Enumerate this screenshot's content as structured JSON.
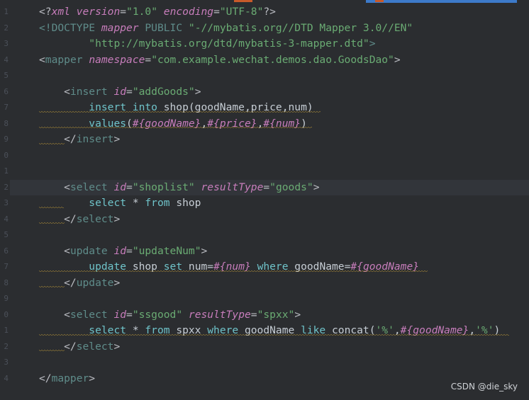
{
  "editor": {
    "lines": [
      {
        "parts": [
          [
            "decl",
            "<?"
          ],
          [
            "attri",
            "xml "
          ],
          [
            "attri",
            "version"
          ],
          [
            "decl",
            "="
          ],
          [
            "val",
            "\"1.0\""
          ],
          [
            "decl",
            " "
          ],
          [
            "attri",
            "encoding"
          ],
          [
            "decl",
            "="
          ],
          [
            "val",
            "\"UTF-8\""
          ],
          [
            "decl",
            "?>"
          ]
        ]
      },
      {
        "parts": [
          [
            "tagc",
            "<!DOCTYPE "
          ],
          [
            "attri",
            "mapper "
          ],
          [
            "tagc",
            "PUBLIC "
          ],
          [
            "val",
            "\"-//mybatis.org//DTD Mapper 3.0//EN\""
          ]
        ]
      },
      {
        "parts": [
          [
            "plain",
            "        "
          ],
          [
            "val",
            "\"http://mybatis.org/dtd/mybatis-3-mapper.dtd\""
          ],
          [
            "tagc",
            ">"
          ]
        ]
      },
      {
        "parts": [
          [
            "plain",
            "<"
          ],
          [
            "tagc",
            "mapper "
          ],
          [
            "attri",
            "namespace"
          ],
          [
            "plain",
            "="
          ],
          [
            "val",
            "\"com.example.wechat.demos.dao.GoodsDao\""
          ],
          [
            "plain",
            ">"
          ]
        ]
      },
      {
        "parts": []
      },
      {
        "parts": [
          [
            "plain",
            "    <"
          ],
          [
            "tagc",
            "insert "
          ],
          [
            "attri",
            "id"
          ],
          [
            "plain",
            "="
          ],
          [
            "val",
            "\"addGoods\""
          ],
          [
            "plain",
            ">"
          ]
        ]
      },
      {
        "parts": [
          [
            "plain",
            "        "
          ],
          [
            "sqlblue",
            "insert into "
          ],
          [
            "sql",
            "shop(goodName"
          ],
          [
            "sql",
            ","
          ],
          [
            "sql",
            "price"
          ],
          [
            "sql",
            ","
          ],
          [
            "sql",
            "num)"
          ]
        ]
      },
      {
        "parts": [
          [
            "plain",
            "        "
          ],
          [
            "sqlblue",
            "values"
          ],
          [
            "sql",
            "("
          ],
          [
            "param",
            "#{goodName}"
          ],
          [
            "sql",
            ","
          ],
          [
            "param",
            "#{price}"
          ],
          [
            "sql",
            ","
          ],
          [
            "param",
            "#{num}"
          ],
          [
            "sql",
            ")"
          ]
        ]
      },
      {
        "parts": [
          [
            "plain",
            "    </"
          ],
          [
            "tagc",
            "insert"
          ],
          [
            "plain",
            ">"
          ]
        ]
      },
      {
        "parts": []
      },
      {
        "parts": []
      },
      {
        "parts": [
          [
            "plain",
            "    <"
          ],
          [
            "tagc",
            "select "
          ],
          [
            "attri",
            "id"
          ],
          [
            "plain",
            "="
          ],
          [
            "val",
            "\"shoplist\""
          ],
          [
            "plain",
            " "
          ],
          [
            "attri",
            "resultType"
          ],
          [
            "plain",
            "="
          ],
          [
            "val",
            "\"goods\""
          ],
          [
            "plain",
            ">"
          ]
        ]
      },
      {
        "parts": [
          [
            "plain",
            "        "
          ],
          [
            "sqlblue",
            "select "
          ],
          [
            "sql",
            "* "
          ],
          [
            "sqlblue",
            "from "
          ],
          [
            "sql",
            "shop"
          ]
        ]
      },
      {
        "parts": [
          [
            "plain",
            "    </"
          ],
          [
            "tagc",
            "select"
          ],
          [
            "plain",
            ">"
          ]
        ]
      },
      {
        "parts": []
      },
      {
        "parts": [
          [
            "plain",
            "    <"
          ],
          [
            "tagc",
            "update "
          ],
          [
            "attri",
            "id"
          ],
          [
            "plain",
            "="
          ],
          [
            "val",
            "\"updateNum\""
          ],
          [
            "plain",
            ">"
          ]
        ]
      },
      {
        "parts": [
          [
            "plain",
            "        "
          ],
          [
            "sqlblue",
            "update "
          ],
          [
            "sql",
            "shop "
          ],
          [
            "sqlblue",
            "set "
          ],
          [
            "sql",
            "num="
          ],
          [
            "param",
            "#{num}"
          ],
          [
            "sql",
            " "
          ],
          [
            "sqlblue",
            "where "
          ],
          [
            "sql",
            "goodName="
          ],
          [
            "param",
            "#{goodName}"
          ]
        ]
      },
      {
        "parts": [
          [
            "plain",
            "    </"
          ],
          [
            "tagc",
            "update"
          ],
          [
            "plain",
            ">"
          ]
        ]
      },
      {
        "parts": []
      },
      {
        "parts": [
          [
            "plain",
            "    <"
          ],
          [
            "tagc",
            "select "
          ],
          [
            "attri",
            "id"
          ],
          [
            "plain",
            "="
          ],
          [
            "val",
            "\"ssgood\""
          ],
          [
            "plain",
            " "
          ],
          [
            "attri",
            "resultType"
          ],
          [
            "plain",
            "="
          ],
          [
            "val",
            "\"spxx\""
          ],
          [
            "plain",
            ">"
          ]
        ]
      },
      {
        "parts": [
          [
            "plain",
            "        "
          ],
          [
            "sqlblue",
            "select "
          ],
          [
            "sql",
            "* "
          ],
          [
            "sqlblue",
            "from "
          ],
          [
            "sql",
            "spxx "
          ],
          [
            "sqlblue",
            "where "
          ],
          [
            "sql",
            "goodName "
          ],
          [
            "sqlblue",
            "like "
          ],
          [
            "sql",
            "concat("
          ],
          [
            "green",
            "'%'"
          ],
          [
            "sql",
            ","
          ],
          [
            "param",
            "#{goodName}"
          ],
          [
            "sql",
            ","
          ],
          [
            "green",
            "'%'"
          ],
          [
            "sql",
            ")"
          ]
        ]
      },
      {
        "parts": [
          [
            "plain",
            "    </"
          ],
          [
            "tagc",
            "select"
          ],
          [
            "plain",
            ">"
          ]
        ]
      },
      {
        "parts": []
      },
      {
        "parts": [
          [
            "plain",
            "</"
          ],
          [
            "tagc",
            "mapper"
          ],
          [
            "plain",
            ">"
          ]
        ]
      }
    ]
  },
  "watermark": "CSDN @die_sky"
}
